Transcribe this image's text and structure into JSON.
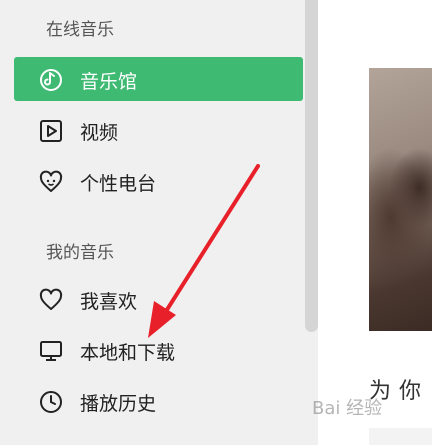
{
  "sidebar": {
    "sections": [
      {
        "title": "在线音乐"
      },
      {
        "title": "我的音乐"
      }
    ],
    "online_items": [
      {
        "label": "音乐馆",
        "icon": "music-hall-icon",
        "active": true
      },
      {
        "label": "视频",
        "icon": "video-play-icon",
        "active": false
      },
      {
        "label": "个性电台",
        "icon": "radio-heart-icon",
        "active": false
      }
    ],
    "my_items": [
      {
        "label": "我喜欢",
        "icon": "heart-icon",
        "active": false
      },
      {
        "label": "本地和下载",
        "icon": "monitor-icon",
        "active": false
      },
      {
        "label": "播放历史",
        "icon": "clock-icon",
        "active": false
      }
    ]
  },
  "main": {
    "hero_caption": "为你"
  },
  "watermark": "Bai 经验",
  "colors": {
    "accent": "#3fba72",
    "sidebar_bg": "#f0f0f0",
    "arrow": "#e8202a"
  }
}
